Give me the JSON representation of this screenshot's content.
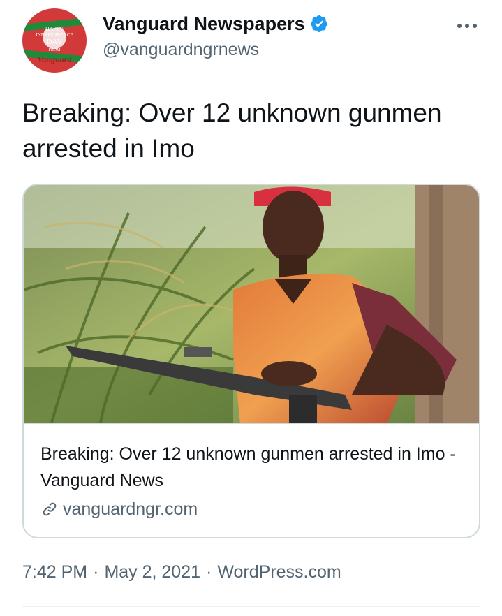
{
  "author": {
    "display_name": "Vanguard Newspapers",
    "handle": "@vanguardngrnews",
    "verified": true,
    "avatar_text": [
      "HAPPY",
      "INDEPENDENCE",
      "DAY",
      "FROM",
      "Vanguard"
    ]
  },
  "tweet": {
    "text": "Breaking: Over 12 unknown gunmen arrested in Imo"
  },
  "card": {
    "title": "Breaking: Over 12 unknown gunmen arrested in Imo - Vanguard News",
    "domain": "vanguardngr.com",
    "image_icon": "photo"
  },
  "meta": {
    "time": "7:42 PM",
    "separator": "·",
    "date": "May 2, 2021",
    "source": "WordPress.com"
  },
  "icons": {
    "more": "more-horizontal-icon",
    "verified": "verified-badge-icon",
    "link": "link-icon"
  },
  "colors": {
    "verified_blue": "#1d9bf0",
    "secondary_text": "#536471",
    "border": "#cfd9de"
  }
}
